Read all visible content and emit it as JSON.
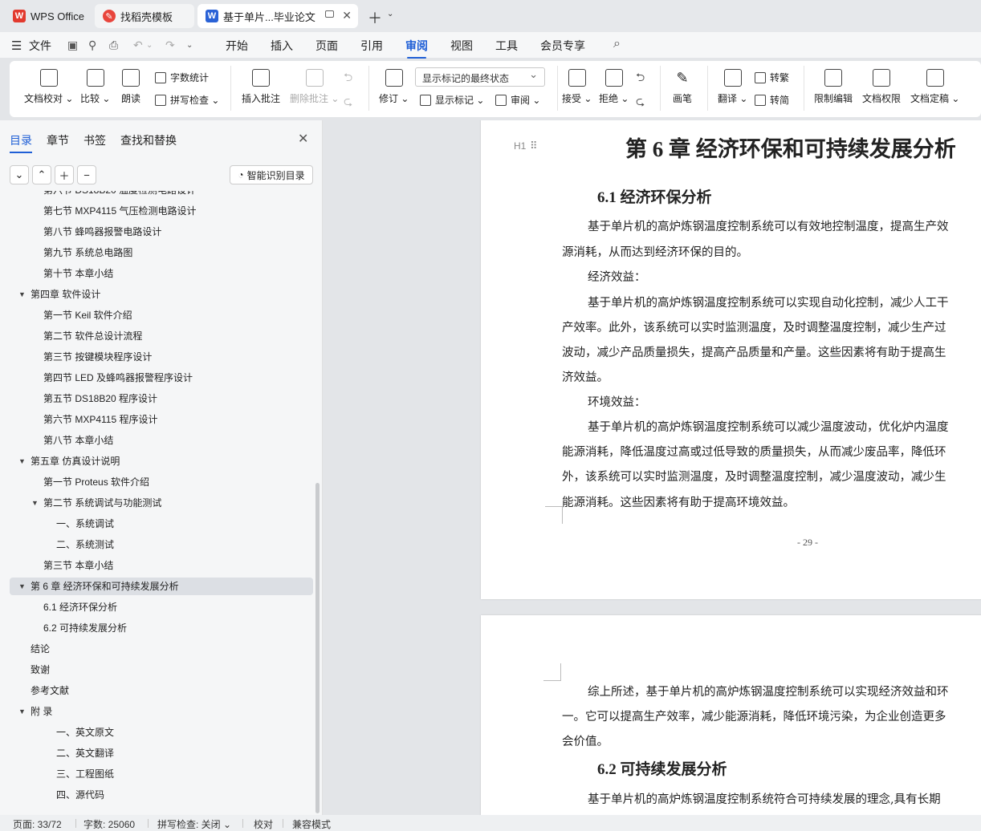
{
  "tabs": {
    "wps": "WPS Office",
    "template": "找稻壳模板",
    "document": "基于单片...毕业论文"
  },
  "menu": {
    "file": "文件",
    "items": [
      "开始",
      "插入",
      "页面",
      "引用",
      "审阅",
      "视图",
      "工具",
      "会员专享"
    ],
    "active": "审阅"
  },
  "ribbon": {
    "doc_proof": "文档校对",
    "compare": "比较",
    "read_aloud": "朗读",
    "word_count": "字数统计",
    "spell_check": "拼写检查",
    "insert_comment": "插入批注",
    "delete_comment": "删除批注",
    "track_changes": "修订",
    "markup_state": "显示标记的最终状态",
    "show_markup": "显示标记",
    "review_pane": "审阅",
    "accept": "接受",
    "reject": "拒绝",
    "pen": "画笔",
    "translate": "翻译",
    "to_traditional": "转繁",
    "to_simplified": "转简",
    "restrict_edit": "限制编辑",
    "doc_permission": "文档权限",
    "doc_finalize": "文档定稿"
  },
  "nav": {
    "tabs": [
      "目录",
      "章节",
      "书签",
      "查找和替换"
    ],
    "active_tab": "目录",
    "smart_toc": "智能识别目录",
    "toc": [
      {
        "text": "第六节   DS18B20 温度检测电路设计",
        "level": 2
      },
      {
        "text": "第七节   MXP4115 气压检测电路设计",
        "level": 2
      },
      {
        "text": "第八节   蜂鸣器报警电路设计",
        "level": 2
      },
      {
        "text": "第九节   系统总电路图",
        "level": 2
      },
      {
        "text": "第十节   本章小结",
        "level": 2
      },
      {
        "text": "第四章   软件设计",
        "level": 1,
        "expanded": true
      },
      {
        "text": "第一节   Keil 软件介绍",
        "level": 2
      },
      {
        "text": "第二节   软件总设计流程",
        "level": 2
      },
      {
        "text": "第三节   按键模块程序设计",
        "level": 2
      },
      {
        "text": "第四节   LED 及蜂鸣器报警程序设计",
        "level": 2
      },
      {
        "text": "第五节   DS18B20 程序设计",
        "level": 2
      },
      {
        "text": "第六节   MXP4115 程序设计",
        "level": 2
      },
      {
        "text": "第八节   本章小结",
        "level": 2
      },
      {
        "text": "第五章   仿真设计说明",
        "level": 1,
        "expanded": true
      },
      {
        "text": "第一节   Proteus 软件介绍",
        "level": 2
      },
      {
        "text": "第二节   系统调试与功能测试",
        "level": 2,
        "expanded": true
      },
      {
        "text": "一、系统调试",
        "level": 3
      },
      {
        "text": "二、系统测试",
        "level": 3
      },
      {
        "text": "第三节   本章小结",
        "level": 2
      },
      {
        "text": "第 6 章  经济环保和可持续发展分析",
        "level": 1,
        "expanded": true,
        "selected": true
      },
      {
        "text": "6.1 经济环保分析",
        "level": 2
      },
      {
        "text": "6.2 可持续发展分析",
        "level": 2
      },
      {
        "text": "结论",
        "level": 1
      },
      {
        "text": "致谢",
        "level": 1
      },
      {
        "text": "参考文献",
        "level": 1
      },
      {
        "text": "附    录",
        "level": 1,
        "expanded": true
      },
      {
        "text": "一、英文原文",
        "level": 3
      },
      {
        "text": "二、英文翻译",
        "level": 3
      },
      {
        "text": "三、工程图纸",
        "level": 3
      },
      {
        "text": "四、源代码",
        "level": 3
      }
    ]
  },
  "document": {
    "heading_marker": "H1",
    "chapter_title": "第 6 章  经济环保和可持续发展分析",
    "section1_title": "6.1 经济环保分析",
    "p1_line1": "基于单片机的高炉炼钢温度控制系统可以有效地控制温度，提高生产效",
    "p1_line2": "源消耗，从而达到经济环保的目的。",
    "economic_label": "经济效益：",
    "p2_line1": "基于单片机的高炉炼钢温度控制系统可以实现自动化控制，减少人工干",
    "p2_line2": "产效率。此外，该系统可以实时监测温度，及时调整温度控制，减少生产过",
    "p2_line3": "波动，减少产品质量损失，提高产品质量和产量。这些因素将有助于提高生",
    "p2_line4": "济效益。",
    "environment_label": "环境效益：",
    "p3_line1": "基于单片机的高炉炼钢温度控制系统可以减少温度波动，优化炉内温度",
    "p3_line2": "能源消耗，降低温度过高或过低导致的质量损失，从而减少废品率，降低环",
    "p3_line3": "外，该系统可以实时监测温度，及时调整温度控制，减少温度波动，减少生",
    "p3_line4": "能源消耗。这些因素将有助于提高环境效益。",
    "page_number": "- 29 -",
    "p4_line1": "综上所述，基于单片机的高炉炼钢温度控制系统可以实现经济效益和环",
    "p4_line2": "一。它可以提高生产效率，减少能源消耗，降低环境污染，为企业创造更多",
    "p4_line3": "会价值。",
    "section2_title": "6.2 可持续发展分析",
    "p5_line1": "基于单片机的高炉炼钢温度控制系统符合可持续发展的理念,具有长期"
  },
  "status": {
    "page": "页面: 33/72",
    "words": "字数: 25060",
    "spell": "拼写检查: 关闭",
    "proof": "校对",
    "compat": "兼容模式"
  },
  "colors": {
    "accent": "#1f5fd6",
    "wps_red": "#e23a2e",
    "doc_blue": "#2a62d6"
  }
}
